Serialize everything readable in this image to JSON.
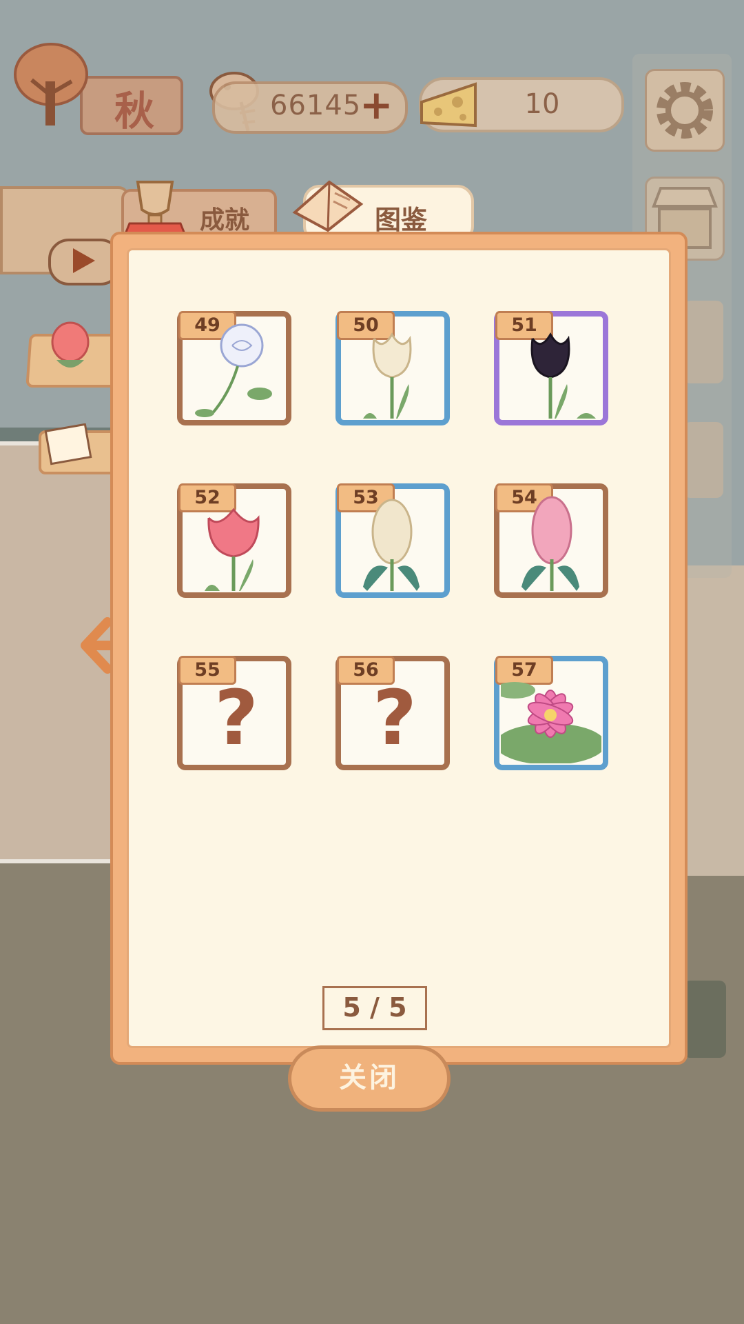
{
  "hud": {
    "season": "秋",
    "coins": "66145",
    "cheese": "10"
  },
  "tabs": {
    "achievements": "成就",
    "collection": "图鉴"
  },
  "collection": {
    "cards": [
      {
        "number": "49",
        "rarity": "common",
        "flower": "white-rose",
        "unlocked": true
      },
      {
        "number": "50",
        "rarity": "rare",
        "flower": "white-tulip",
        "unlocked": true
      },
      {
        "number": "51",
        "rarity": "epic",
        "flower": "black-tulip",
        "unlocked": true
      },
      {
        "number": "52",
        "rarity": "common",
        "flower": "pink-tulip",
        "unlocked": true
      },
      {
        "number": "53",
        "rarity": "rare",
        "flower": "white-hyacinth",
        "unlocked": true
      },
      {
        "number": "54",
        "rarity": "common",
        "flower": "pink-hyacinth",
        "unlocked": true
      },
      {
        "number": "55",
        "rarity": "common",
        "flower": "unknown",
        "unlocked": false
      },
      {
        "number": "56",
        "rarity": "common",
        "flower": "unknown",
        "unlocked": false
      },
      {
        "number": "57",
        "rarity": "rare",
        "flower": "water-lily",
        "unlocked": true
      }
    ],
    "unknown_glyph": "?",
    "page": "5 / 5"
  },
  "footer": {
    "close_label": "关闭"
  },
  "colors": {
    "common_border": "#a8714f",
    "rare_border": "#5d9fce",
    "epic_border": "#9b76d8",
    "panel": "#f2b27e"
  }
}
